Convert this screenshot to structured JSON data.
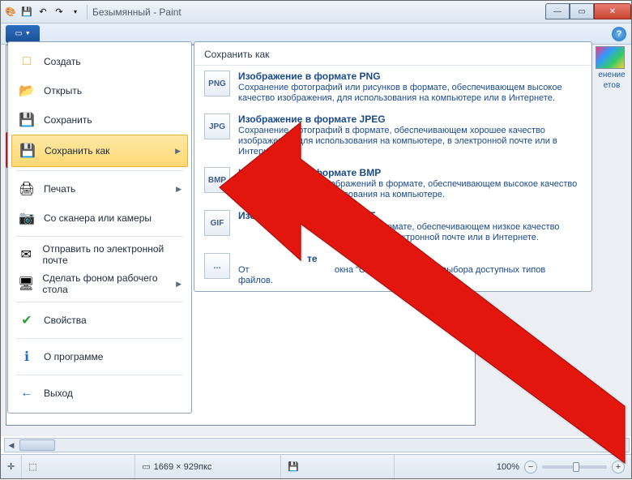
{
  "window": {
    "title": "Безымянный - Paint"
  },
  "menu": {
    "create": "Создать",
    "open": "Открыть",
    "save": "Сохранить",
    "save_as": "Сохранить как",
    "print": "Печать",
    "scanner": "Со сканера или камеры",
    "email": "Отправить по электронной почте",
    "wallpaper": "Сделать фоном рабочего стола",
    "properties": "Свойства",
    "about": "О программе",
    "exit": "Выход"
  },
  "submenu": {
    "header": "Сохранить как",
    "png": {
      "title": "Изображение в формате PNG",
      "desc": "Сохранение фотографий или рисунков в формате, обеспечивающем высокое качество изображения, для использования на компьютере или в Интернете."
    },
    "jpeg": {
      "title": "Изображение в формате JPEG",
      "desc": "Сохранение фотографий в формате, обеспечивающем хорошее качество изображения, для использования на компьютере, в электронной почте или в Интернете."
    },
    "bmp": {
      "title": "Изображение в формате BMP",
      "desc": "Сохранение любых изображений в формате, обеспечивающем высокое качество изображения, для использования на компьютере."
    },
    "gif": {
      "title": "Изображение в формате GIF",
      "desc_a": "рисунков в формате, обеспечивающем низкое качество",
      "desc_b": "зования в электронной почте или в Интернете."
    },
    "other": {
      "title_b": "те",
      "desc_a": "От",
      "desc_b": "окна \"Сохранить как\" для выбора доступных типов файлов."
    }
  },
  "side_panel": {
    "label1": "енение",
    "label2": "етов"
  },
  "status": {
    "dimensions": "1669 × 929пкс",
    "zoom": "100%"
  },
  "icons": {
    "cursor": "↖",
    "png": "PNG",
    "jpg": "JPG",
    "bmp": "BMP",
    "gif": "GIF",
    "oth": "…"
  }
}
